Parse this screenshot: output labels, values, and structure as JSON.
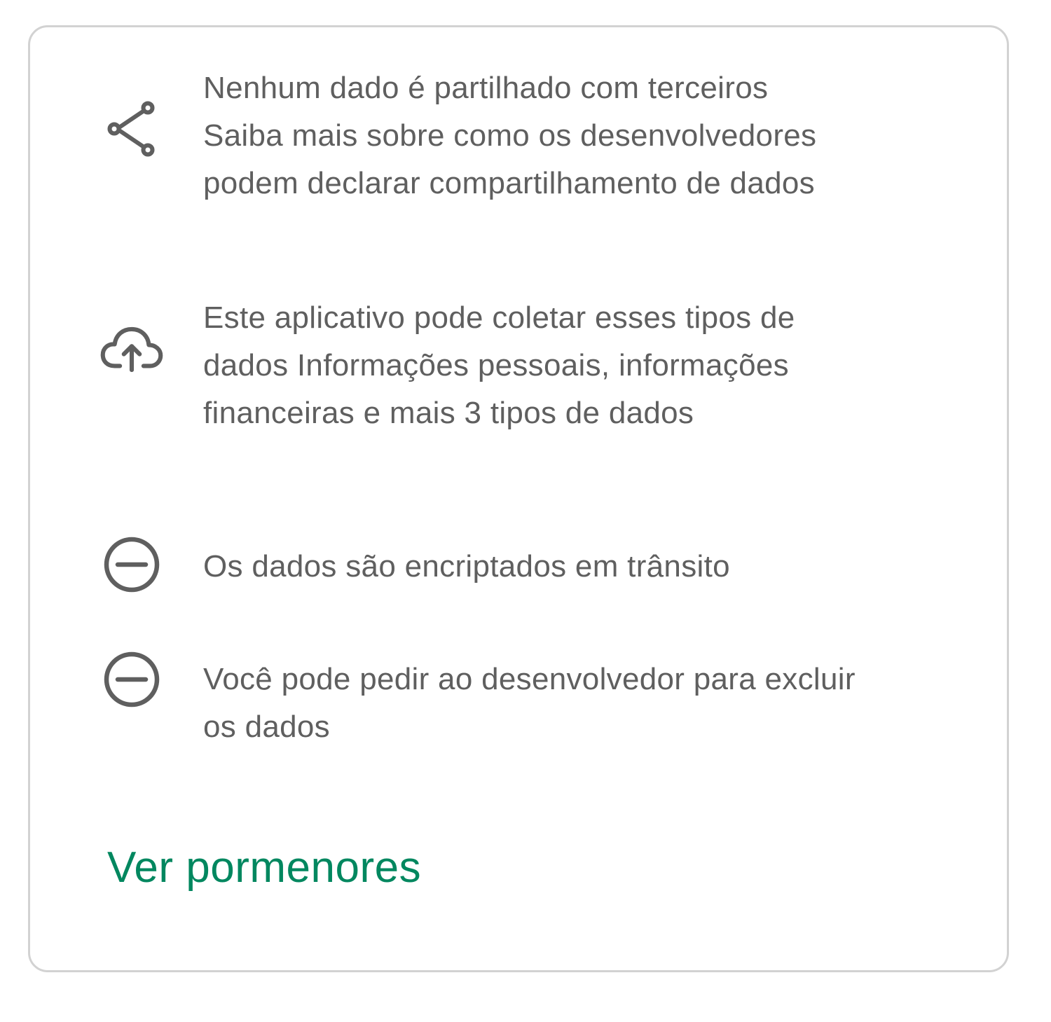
{
  "data_safety": {
    "items": [
      {
        "icon": "share-icon",
        "lines": [
          "Nenhum dado é partilhado com terceiros",
          "Saiba mais sobre como os desenvolvedores",
          "podem declarar compartilhamento de dados"
        ]
      },
      {
        "icon": "cloud-upload-icon",
        "lines": [
          "Este aplicativo pode coletar esses tipos de",
          "dados Informações pessoais, informações",
          "financeiras e mais 3 tipos de dados"
        ]
      },
      {
        "icon": "minus-circle-icon",
        "lines": [
          "Os dados são encriptados em trânsito"
        ]
      },
      {
        "icon": "minus-circle-icon",
        "lines": [
          "Você pode pedir ao desenvolvedor para excluir",
          "os dados"
        ]
      }
    ],
    "details_link": "Ver pormenores"
  },
  "colors": {
    "text": "#5f5f5f",
    "icon": "#5f5f5f",
    "link": "#01875f",
    "border": "#d2d2d2"
  }
}
